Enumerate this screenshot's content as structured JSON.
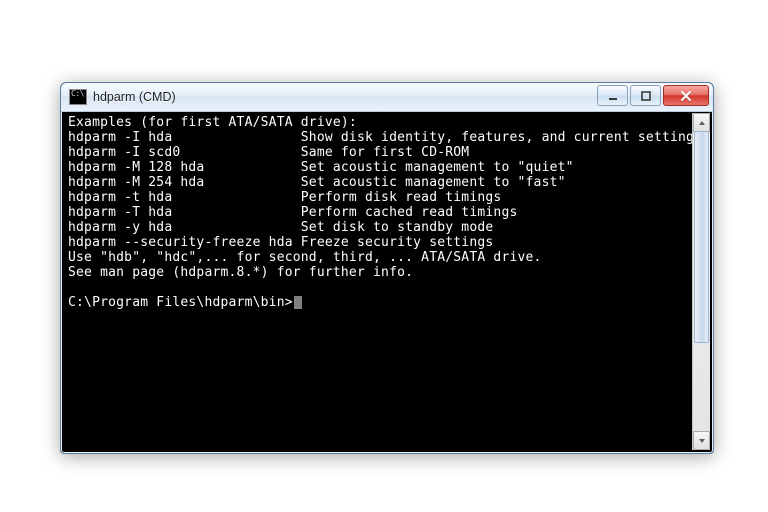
{
  "window": {
    "title": "hdparm (CMD)"
  },
  "terminal": {
    "head": "Examples (for first ATA/SATA drive):",
    "rows": [
      {
        "cmd": "hdparm -I hda",
        "desc": "Show disk identity, features, and current settings"
      },
      {
        "cmd": "hdparm -I scd0",
        "desc": "Same for first CD-ROM"
      },
      {
        "cmd": "hdparm -M 128 hda",
        "desc": "Set acoustic management to \"quiet\""
      },
      {
        "cmd": "hdparm -M 254 hda",
        "desc": "Set acoustic management to \"fast\""
      },
      {
        "cmd": "hdparm -t hda",
        "desc": "Perform disk read timings"
      },
      {
        "cmd": "hdparm -T hda",
        "desc": "Perform cached read timings"
      },
      {
        "cmd": "hdparm -y hda",
        "desc": "Set disk to standby mode"
      },
      {
        "cmd": "hdparm --security-freeze hda",
        "desc": "Freeze security settings"
      }
    ],
    "hint1": "Use \"hdb\", \"hdc\",... for second, third, ... ATA/SATA drive.",
    "hint2": "See man page (hdparm.8.*) for further info.",
    "prompt": "C:\\Program Files\\hdparm\\bin>"
  },
  "colors": {
    "term_bg": "#000000",
    "term_fg": "#ffffff",
    "close_red": "#d7463c"
  }
}
